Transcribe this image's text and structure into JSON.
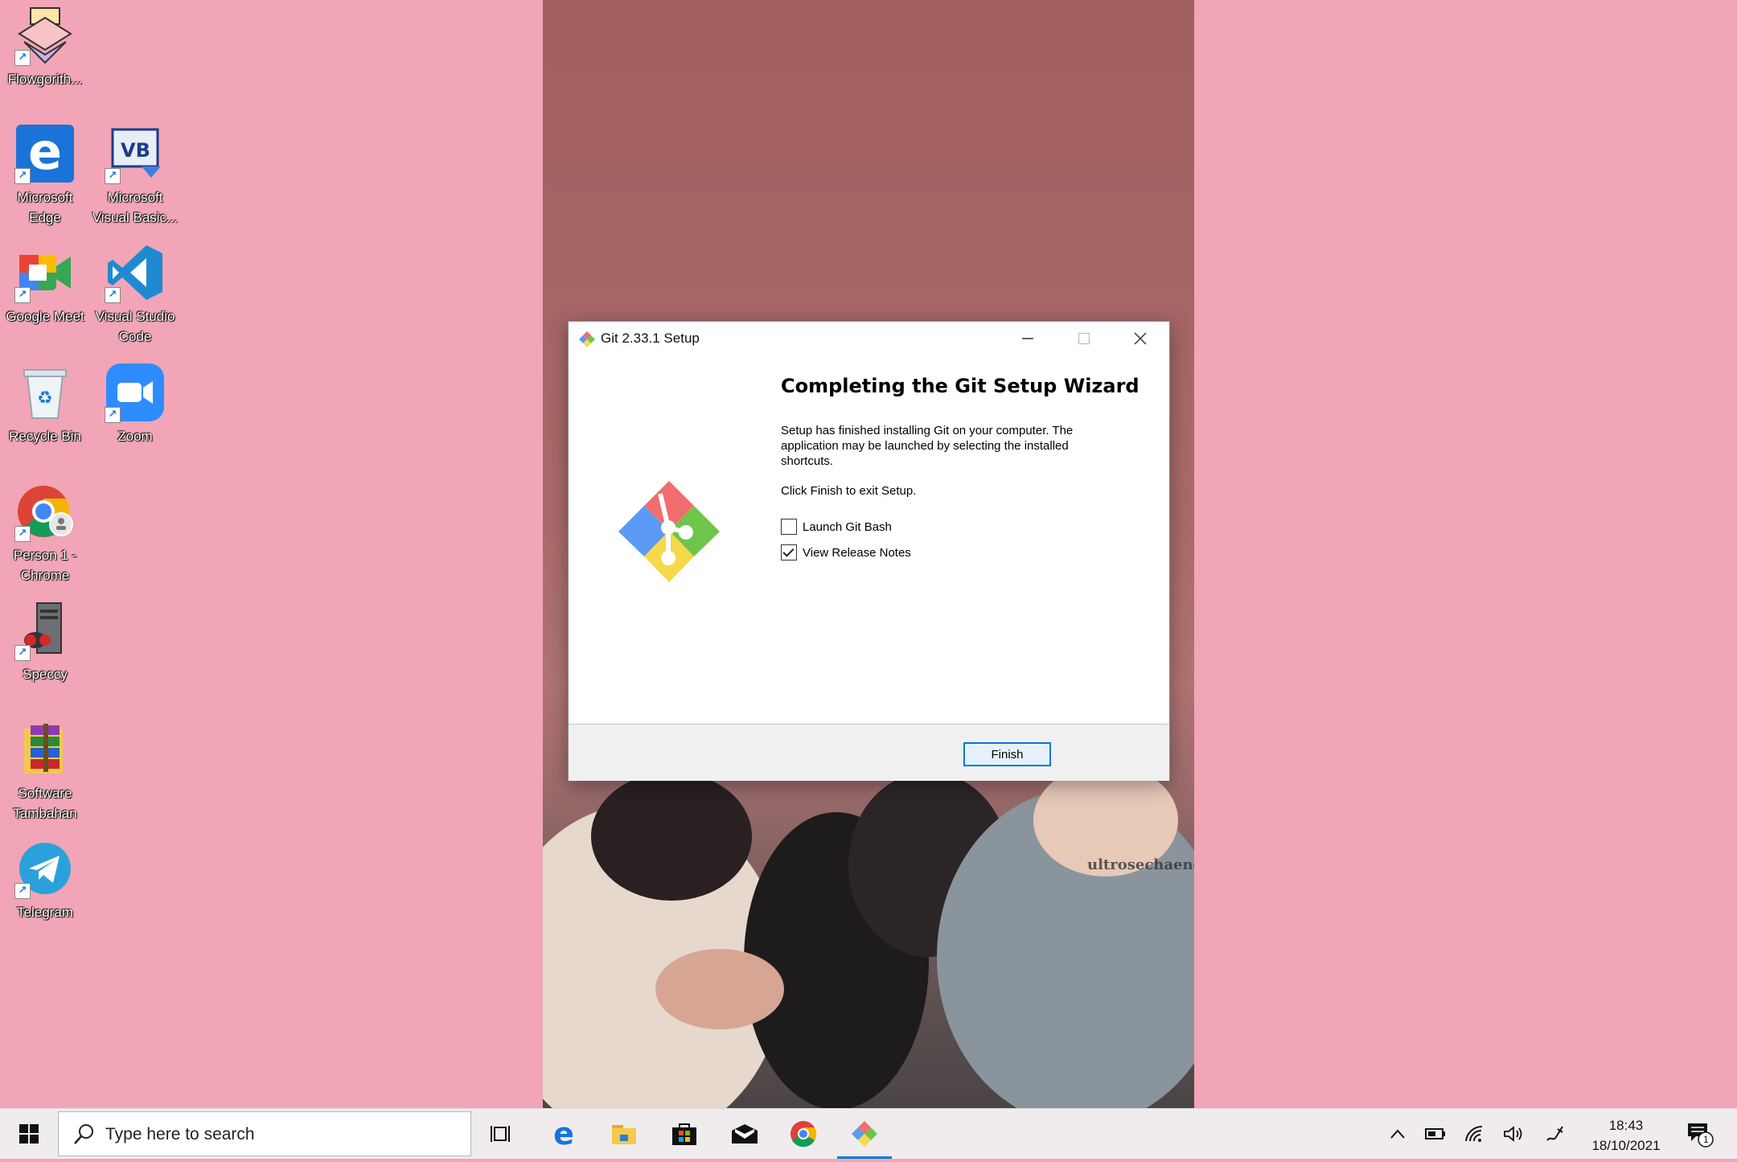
{
  "desktop": {
    "icons": [
      {
        "label": "Flowgorith...",
        "icon": "flowgorithm-icon"
      },
      {
        "label": "Microsoft Edge",
        "icon": "edge-icon"
      },
      {
        "label": "Microsoft Visual Basic...",
        "icon": "visual-basic-icon"
      },
      {
        "label": "Google Meet",
        "icon": "google-meet-icon"
      },
      {
        "label": "Visual Studio Code",
        "icon": "vscode-icon"
      },
      {
        "label": "Recycle Bin",
        "icon": "recycle-bin-icon"
      },
      {
        "label": "Zoom",
        "icon": "zoom-icon"
      },
      {
        "label": "Person 1 - Chrome",
        "icon": "chrome-profile-icon"
      },
      {
        "label": "Speccy",
        "icon": "speccy-icon"
      },
      {
        "label": "Software Tambahan",
        "icon": "rar-archive-icon"
      },
      {
        "label": "Telegram",
        "icon": "telegram-icon"
      }
    ],
    "wallpaper_watermark": "ultrosechaeng."
  },
  "dialog": {
    "title": "Git 2.33.1 Setup",
    "heading": "Completing the Git Setup Wizard",
    "paragraph1": "Setup has finished installing Git on your computer. The application may be launched by selecting the installed shortcuts.",
    "paragraph2": "Click Finish to exit Setup.",
    "options": [
      {
        "label": "Launch Git Bash",
        "checked": false
      },
      {
        "label": "View Release Notes",
        "checked": true
      }
    ],
    "finish_label": "Finish"
  },
  "taskbar": {
    "search_placeholder": "Type here to search",
    "pinned": [
      "task-view-icon",
      "edge-icon",
      "file-explorer-icon",
      "microsoft-store-icon",
      "mail-icon",
      "chrome-icon",
      "git-setup-icon"
    ],
    "time": "18:43",
    "date": "18/10/2021",
    "notification_count": "1"
  },
  "colors": {
    "desktop_bg": "#f2a5b6",
    "accent": "#0078d7",
    "git_red": "#f06e6e",
    "git_green": "#6fc44a",
    "git_blue": "#5b9bf3",
    "git_yellow": "#f5d84c"
  }
}
